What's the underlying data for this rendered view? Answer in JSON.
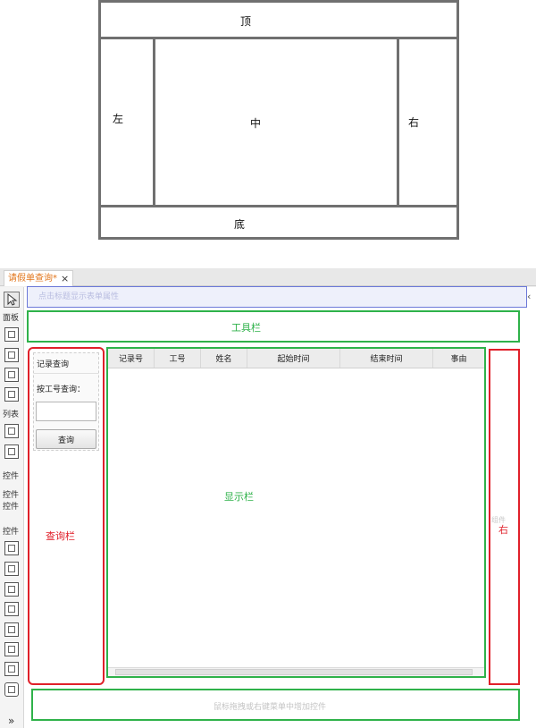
{
  "layout_diagram": {
    "top": "顶",
    "left": "左",
    "center": "中",
    "right": "右",
    "bottom": "底"
  },
  "designer": {
    "tab": {
      "title": "请假单查询*",
      "close": "×"
    },
    "palette": {
      "labels": [
        "面板",
        "列表",
        "控件",
        "控件",
        "控件",
        "控件"
      ],
      "more": "»"
    },
    "property_hint": "点击标题显示表单属性",
    "toolbar_label": "工具栏",
    "query_panel": {
      "title": "记录查询",
      "field_label": "按工号查询：",
      "field_value": "",
      "button": "查询",
      "region_label": "查询栏"
    },
    "grid": {
      "columns": [
        "记录号",
        "工号",
        "姓名",
        "起始时间",
        "结束时间",
        "事由"
      ],
      "region_label": "显示栏"
    },
    "right_panel": {
      "label": "右",
      "faint_label": "组件"
    },
    "bottom_hint": "鼠标拖拽或右键菜单中增加控件"
  }
}
